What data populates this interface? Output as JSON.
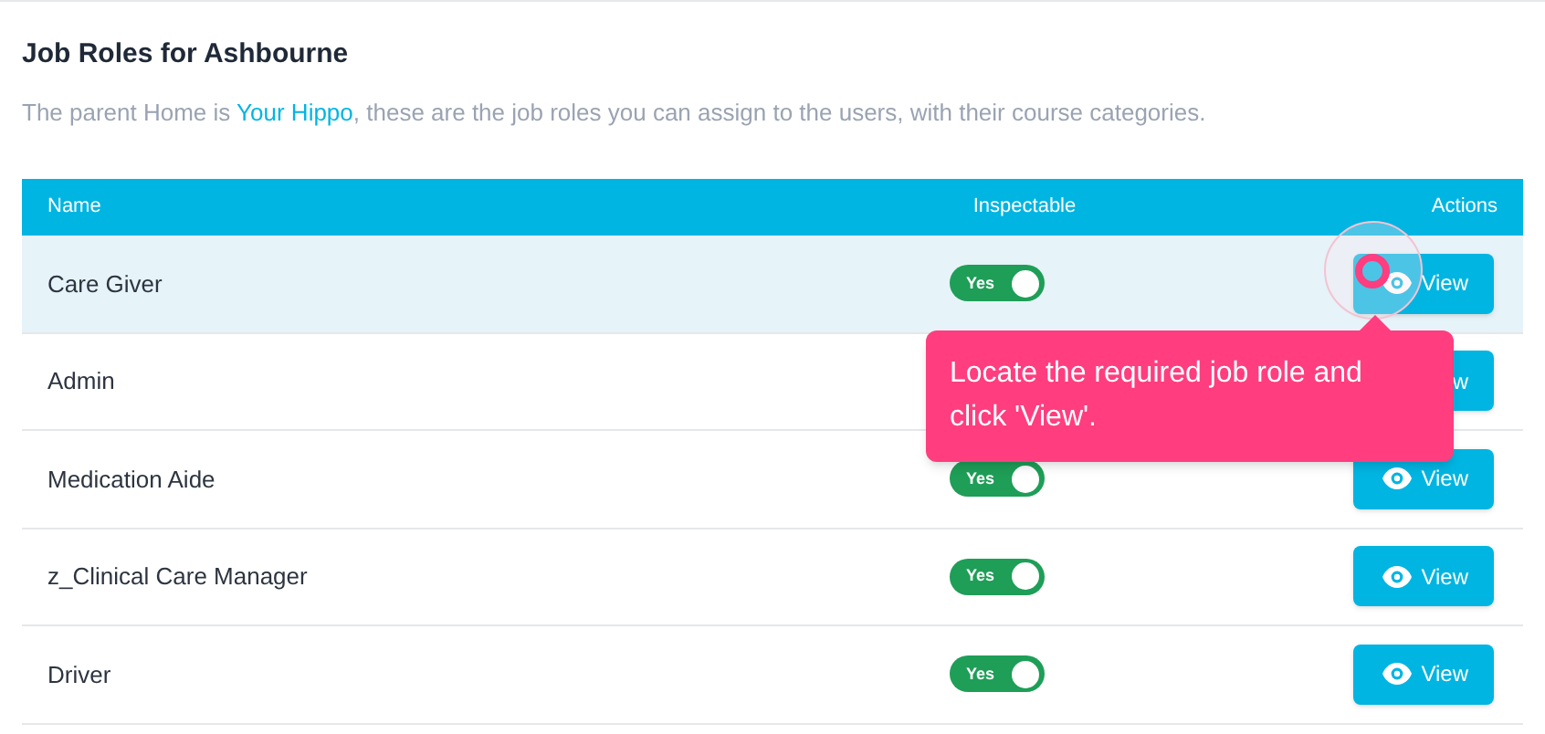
{
  "title": "Job Roles for Ashbourne",
  "description": {
    "before": "The parent Home is ",
    "link": "Your Hippo",
    "after": ", these are the job roles you can assign to the users, with their course categories."
  },
  "table": {
    "columns": [
      "Name",
      "Inspectable",
      "Actions"
    ],
    "rows": [
      {
        "name": "Care Giver",
        "selected": true,
        "inspectable": {
          "label": "Yes",
          "on": true
        },
        "action": "View"
      },
      {
        "name": "Admin",
        "selected": false,
        "action": "w"
      },
      {
        "name": "Medication Aide",
        "selected": false,
        "inspectable": {
          "label": "Yes",
          "on": true
        },
        "action": "View"
      },
      {
        "name": "z_Clinical Care Manager",
        "selected": false,
        "inspectable": {
          "label": "Yes",
          "on": true
        },
        "action": "View"
      },
      {
        "name": "Driver",
        "selected": false,
        "inspectable": {
          "label": "Yes",
          "on": true
        },
        "action": "View"
      }
    ]
  },
  "tooltip": {
    "text": "Locate the required job role and click 'View'."
  }
}
